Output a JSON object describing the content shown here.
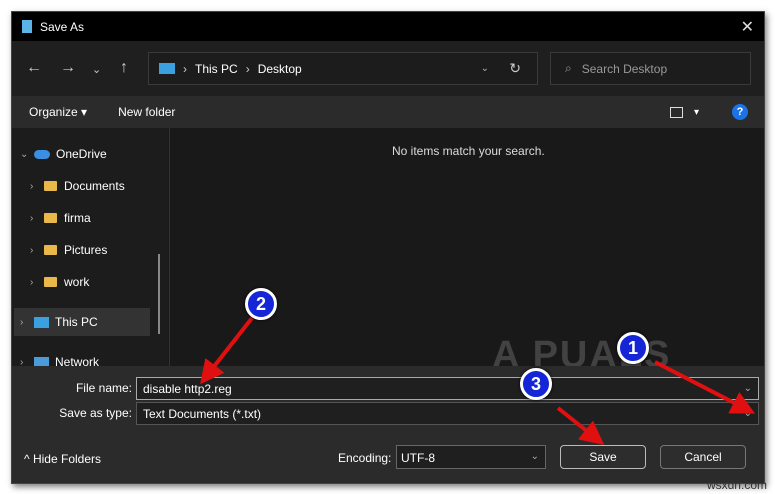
{
  "window": {
    "title": "Save As",
    "close_icon": "close-icon"
  },
  "nav": {
    "breadcrumb": [
      "This PC",
      "Desktop"
    ],
    "search_placeholder": "Search Desktop"
  },
  "toolbar": {
    "organize": "Organize",
    "new_folder": "New folder",
    "help": "?"
  },
  "sidebar": {
    "items": [
      {
        "label": "OneDrive"
      },
      {
        "label": "Documents"
      },
      {
        "label": "firma"
      },
      {
        "label": "Pictures"
      },
      {
        "label": "work"
      },
      {
        "label": "This PC"
      },
      {
        "label": "Network"
      }
    ]
  },
  "main": {
    "empty_message": "No items match your search."
  },
  "form": {
    "file_name_label": "File name:",
    "file_name_value": "disable http2.reg",
    "type_label": "Save as type:",
    "type_value": "Text Documents (*.txt)",
    "encoding_label": "Encoding:",
    "encoding_value": "UTF-8",
    "save": "Save",
    "cancel": "Cancel",
    "hide_folders": "Hide Folders"
  },
  "annotations": {
    "badges": [
      "1",
      "2",
      "3"
    ],
    "arrow_color": "#e01010"
  },
  "watermarks": {
    "logo": "APPUALS",
    "site": "wsxdn.com"
  }
}
